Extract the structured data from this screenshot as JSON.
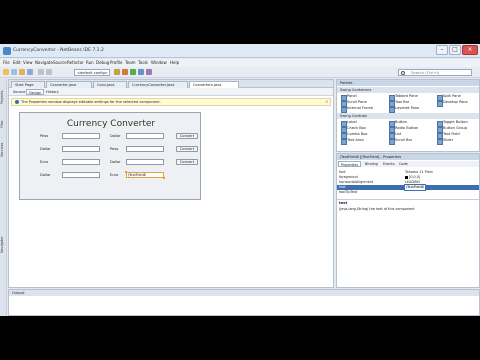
{
  "window": {
    "title": "CurrencyConverter - NetBeans IDE 7.1.2",
    "controls": [
      "–",
      "□",
      "×"
    ]
  },
  "menu": [
    "File",
    "Edit",
    "View",
    "Navigate",
    "Source",
    "Refactor",
    "Run",
    "Debug",
    "Profile",
    "Team",
    "Tools",
    "Window",
    "Help"
  ],
  "toolbar": {
    "config_value": "<default config>",
    "search_placeholder": "Search (Ctrl+I)"
  },
  "left_tabs": [
    "Projects",
    "Files",
    "Services",
    "Navigator"
  ],
  "editor": {
    "tabs": [
      "Start Page",
      "Converter.java",
      "Conv.java",
      "CurrencyConverter.java",
      "Converters.java"
    ],
    "view_tabs": [
      "Source",
      "Design",
      "History"
    ],
    "info_message": "The Properties window displays editable settings for the selected component.",
    "form": {
      "title": "Currency Converter",
      "left_labels": [
        "Peso",
        "Dollar",
        "Euro",
        "Dollar"
      ],
      "right_labels": [
        "Dollar",
        "Peso",
        "Dollar",
        "Euro"
      ],
      "button_label": "Convert",
      "selected_field_text": "jTextField8"
    }
  },
  "palette": {
    "title": "Palette",
    "sections": [
      {
        "name": "Swing Containers",
        "items": [
          "Panel",
          "Tabbed Pane",
          "Split Pane",
          "Scroll Pane",
          "Tool Bar",
          "Desktop Pane",
          "Internal Frame",
          "Layered Pane"
        ]
      },
      {
        "name": "Swing Controls",
        "items": [
          "Label",
          "Button",
          "Toggle Button",
          "Check Box",
          "Radio Button",
          "Button Group",
          "Combo Box",
          "List",
          "Text Field",
          "Text Area",
          "Scroll Bar",
          "Slider"
        ]
      }
    ]
  },
  "properties": {
    "header": "jTextField8 [JTextField] - Properties",
    "tabs": [
      "Properties",
      "Binding",
      "Events",
      "Code"
    ],
    "rows": [
      {
        "name": "font",
        "value": "Tahoma 11 Plain"
      },
      {
        "name": "foreground",
        "value": "[0,0,0]"
      },
      {
        "name": "horizontalAlignment",
        "value": "LEADING"
      },
      {
        "name": "text",
        "value": "jTextField8"
      },
      {
        "name": "toolTipText",
        "value": ""
      }
    ],
    "desc_title": "text",
    "desc_text": "(java.lang.String) the text of this component"
  },
  "output": {
    "title": "Output"
  },
  "colors": {
    "accent": "#3a6fb8",
    "selection": "#3d6fb0"
  }
}
